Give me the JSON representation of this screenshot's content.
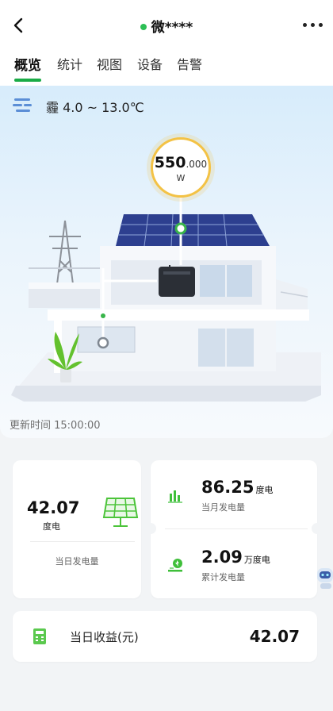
{
  "header": {
    "title": "微****",
    "status_color": "#2cbf55"
  },
  "tabs": [
    {
      "label": "概览",
      "active": true
    },
    {
      "label": "统计",
      "active": false
    },
    {
      "label": "视图",
      "active": false
    },
    {
      "label": "设备",
      "active": false
    },
    {
      "label": "告警",
      "active": false
    }
  ],
  "weather": {
    "icon": "haze-icon",
    "text": "霾 4.0 ~ 13.0℃"
  },
  "power": {
    "main": "550",
    "decimal": ".000",
    "unit": "W"
  },
  "update_time": "更新时间 15:00:00",
  "today": {
    "value": "42.07",
    "unit": "度电",
    "label": "当日发电量",
    "icon": "solar-panel-icon"
  },
  "month": {
    "value": "86.25",
    "unit": "度电",
    "label": "当月发电量",
    "icon": "bar-chart-icon"
  },
  "total": {
    "value": "2.09",
    "unit": "万度电",
    "label": "累计发电量",
    "icon": "energy-icon"
  },
  "income": {
    "label": "当日收益(元)",
    "value": "42.07",
    "icon": "calculator-icon"
  },
  "colors": {
    "accent": "#1aab46",
    "bubble_ring": "#f3c245"
  }
}
